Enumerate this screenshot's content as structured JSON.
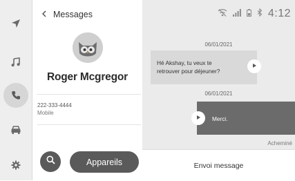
{
  "nav_rail": {
    "items": [
      {
        "icon": "navigation-arrow-icon",
        "active": false
      },
      {
        "icon": "music-note-icon",
        "active": false
      },
      {
        "icon": "phone-icon",
        "active": true
      },
      {
        "icon": "car-icon",
        "active": false
      },
      {
        "icon": "settings-gear-icon",
        "active": false
      }
    ]
  },
  "header": {
    "back_icon": "chevron-left-icon",
    "title": "Messages"
  },
  "contact": {
    "name": "Roger Mcgregor",
    "phone_number": "222-333-4444",
    "phone_type": "Mobile",
    "avatar_icon": "owl-avatar-icon"
  },
  "actions": {
    "search_icon": "search-icon",
    "devices_label": "Appareils"
  },
  "status_bar": {
    "icons": [
      "no-signal-icon",
      "signal-bars-icon",
      "battery-icon",
      "bluetooth-icon"
    ],
    "time": "4:12"
  },
  "messages": [
    {
      "date": "06/01/2021",
      "direction": "incoming",
      "text_line1": "Hé Akshay, tu veux te",
      "text_line2": "retrouver pour déjeuner?",
      "play_icon": "play-icon"
    },
    {
      "date": "06/01/2021",
      "direction": "outgoing",
      "text": "Merci.",
      "play_icon": "play-icon",
      "status": "Acheminé"
    }
  ],
  "compose": {
    "label": "Envoi message"
  },
  "colors": {
    "rail_bg": "#eeeeee",
    "conversation_bg": "#ebebeb",
    "incoming_bubble": "#d9d9d9",
    "outgoing_bubble": "#6b6b6b",
    "button_dark": "#5a5a5a"
  }
}
